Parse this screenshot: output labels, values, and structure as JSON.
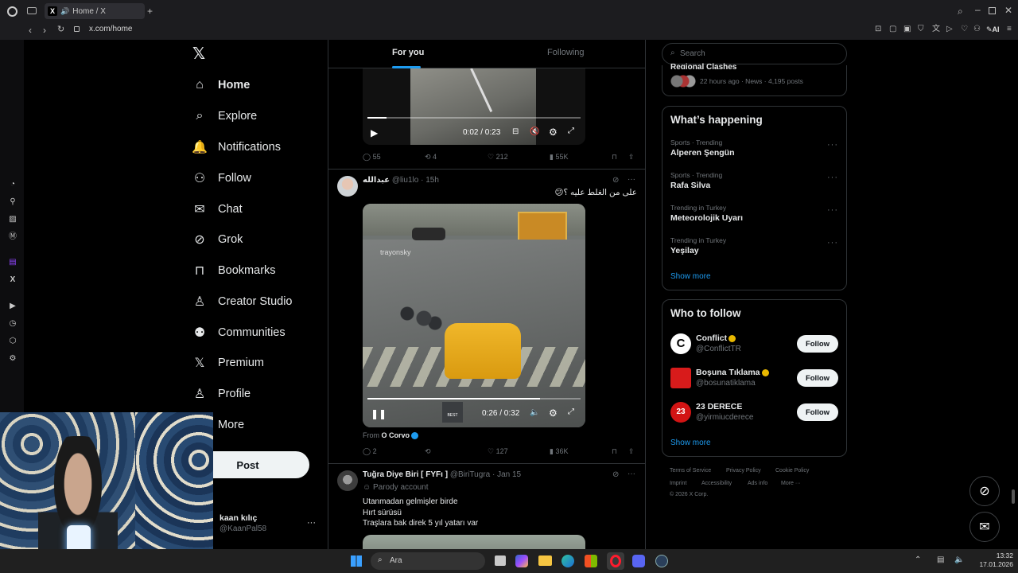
{
  "browser": {
    "tab_title": "Home / X",
    "url": "x.com/home",
    "ai_label": "AI"
  },
  "nav": {
    "items": [
      {
        "label": "Home",
        "icon": "home-icon"
      },
      {
        "label": "Explore",
        "icon": "search-icon"
      },
      {
        "label": "Notifications",
        "icon": "bell-icon"
      },
      {
        "label": "Follow",
        "icon": "add-user-icon"
      },
      {
        "label": "Chat",
        "icon": "mail-icon"
      },
      {
        "label": "Grok",
        "icon": "grok-icon"
      },
      {
        "label": "Bookmarks",
        "icon": "bookmark-icon"
      },
      {
        "label": "Creator Studio",
        "icon": "creator-studio-icon"
      },
      {
        "label": "Communities",
        "icon": "communities-icon"
      },
      {
        "label": "Premium",
        "icon": "x-logo-icon"
      },
      {
        "label": "Profile",
        "icon": "person-icon"
      },
      {
        "label": "More",
        "icon": "more-icon"
      }
    ],
    "post_label": "Post",
    "account": {
      "name": "kaan kılıç",
      "handle": "@KaanPal58"
    }
  },
  "feed": {
    "tabs": {
      "for_you": "For you",
      "following": "Following"
    },
    "post1": {
      "time": "0:02 / 0:23",
      "progress": 0.09,
      "replies": "55",
      "reposts": "4",
      "likes": "212",
      "views": "55K"
    },
    "post2": {
      "name": "عبدالله",
      "handle": "@liu1lo",
      "age": "15h",
      "text": "على من الغلط عليه ؟😕",
      "video_watermark": "trayonsky",
      "time": "0:26 / 0:32",
      "progress": 0.81,
      "from_label": "From",
      "from_source": "O Corvo",
      "replies": "2",
      "likes": "127",
      "views": "36K"
    },
    "post3": {
      "name": "Tuğra Diye Biri [ FYFı ]",
      "handle": "@BiriTugra",
      "age": "Jan 15",
      "badge": "Parody account",
      "lines": [
        "Utanmadan gelmişler birde",
        "Hırt sürüsü",
        "Traşlara bak direk 5 yıl yatarı var"
      ]
    }
  },
  "search": {
    "placeholder": "Search"
  },
  "top_card": {
    "title": "Regional Clashes",
    "meta": "22 hours ago · News · 4,195 posts"
  },
  "happening": {
    "title": "What’s happening",
    "trends": [
      {
        "category": "Sports · Trending",
        "name": "Alperen Şengün"
      },
      {
        "category": "Sports · Trending",
        "name": "Rafa Silva"
      },
      {
        "category": "Trending in Turkey",
        "name": "Meteorolojik Uyarı"
      },
      {
        "category": "Trending in Turkey",
        "name": "Yeşilay"
      }
    ],
    "show_more": "Show more"
  },
  "who_to_follow": {
    "title": "Who to follow",
    "accounts": [
      {
        "name": "Conflict",
        "handle": "@ConflictTR",
        "button": "Follow"
      },
      {
        "name": "Boşuna Tıklama",
        "handle": "@bosunatiklama",
        "button": "Follow"
      },
      {
        "name": "23 DERECE",
        "handle": "@yirmiucderece",
        "button": "Follow"
      }
    ],
    "show_more": "Show more"
  },
  "footer": {
    "links": [
      "Terms of Service",
      "Privacy Policy",
      "Cookie Policy",
      "Imprint",
      "Accessibility",
      "Ads info",
      "More ···"
    ],
    "copyright": "© 2026 X Corp."
  },
  "taskbar": {
    "search_placeholder": "Ara",
    "clock_time": "13:32",
    "clock_date": "17.01.2026"
  },
  "colors": {
    "accent": "#1d9bf0",
    "background": "#000000",
    "border": "#2f3336",
    "muted": "#71767b"
  }
}
